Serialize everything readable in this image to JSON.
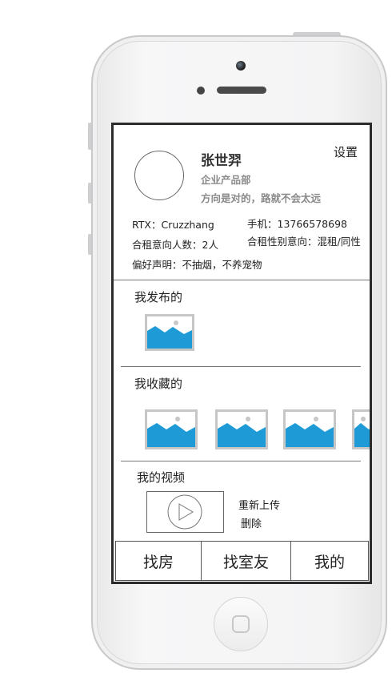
{
  "profile": {
    "name": "张世羿",
    "department": "企业产品部",
    "motto": "方向是对的，路就不会太远",
    "settings_label": "设置",
    "rtx": "RTX：Cruzzhang",
    "phone": "手机：13766578698",
    "co_rent_count": "合租意向人数：2人",
    "co_rent_gender": "合租性别意向：混租/同性",
    "preference": "偏好声明：不抽烟，不养宠物"
  },
  "sections": {
    "published": "我发布的",
    "favorites": "我收藏的",
    "videos": "我的视频"
  },
  "video_actions": {
    "reupload": "重新上传",
    "delete": "删除"
  },
  "tabs": [
    {
      "label": "找房"
    },
    {
      "label": "找室友"
    },
    {
      "label": "我的"
    }
  ],
  "colors": {
    "image_placeholder": "#1e9bd7",
    "thumb_border": "#c7c7c7",
    "screen_border": "#2c2c2c"
  },
  "icons": {
    "image_placeholder": "image-icon",
    "video_play": "play-icon"
  }
}
